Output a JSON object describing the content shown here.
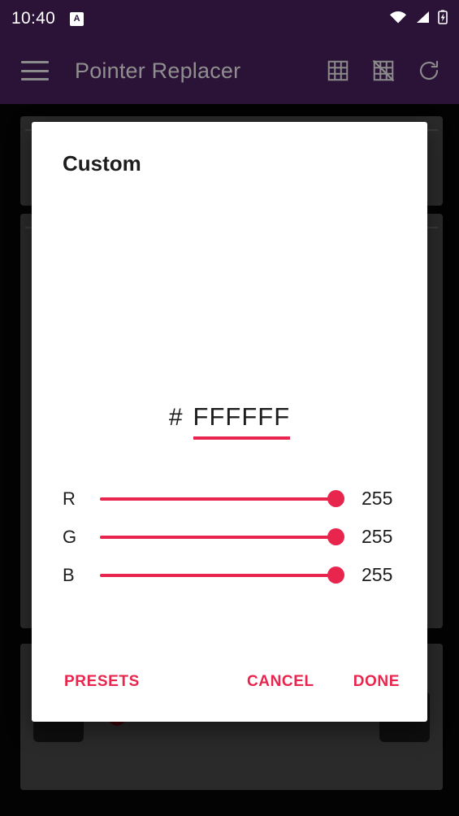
{
  "status_bar": {
    "time": "10:40",
    "badge_letter": "A",
    "icons": [
      "wifi-icon",
      "cellular-signal-icon",
      "battery-charging-icon"
    ]
  },
  "toolbar": {
    "menu_icon": "hamburger-menu-icon",
    "title": "Pointer Replacer",
    "actions": [
      {
        "name": "grid-on-icon",
        "label": "Grid on"
      },
      {
        "name": "grid-off-icon",
        "label": "Grid off"
      },
      {
        "name": "refresh-icon",
        "label": "Refresh"
      }
    ]
  },
  "dialog": {
    "title": "Custom",
    "preview_color": "#FFFFFF",
    "hex": {
      "prefix": "#",
      "value": "FFFFFF"
    },
    "channels": [
      {
        "label": "R",
        "value": "255",
        "percent": 100
      },
      {
        "label": "G",
        "value": "255",
        "percent": 100
      },
      {
        "label": "B",
        "value": "255",
        "percent": 100
      }
    ],
    "buttons": {
      "presets": "PRESETS",
      "cancel": "CANCEL",
      "done": "DONE"
    }
  },
  "bottom_bar": {
    "decrease_label": "-",
    "increase_label": "+",
    "slider_percent": 2
  },
  "colors": {
    "accent": "#E8254C",
    "toolbar_bg": "#2B1237",
    "dialog_bg": "#FFFFFF",
    "card_bg": "#6E6E6E",
    "screen_bg": "#0B0A0D"
  }
}
